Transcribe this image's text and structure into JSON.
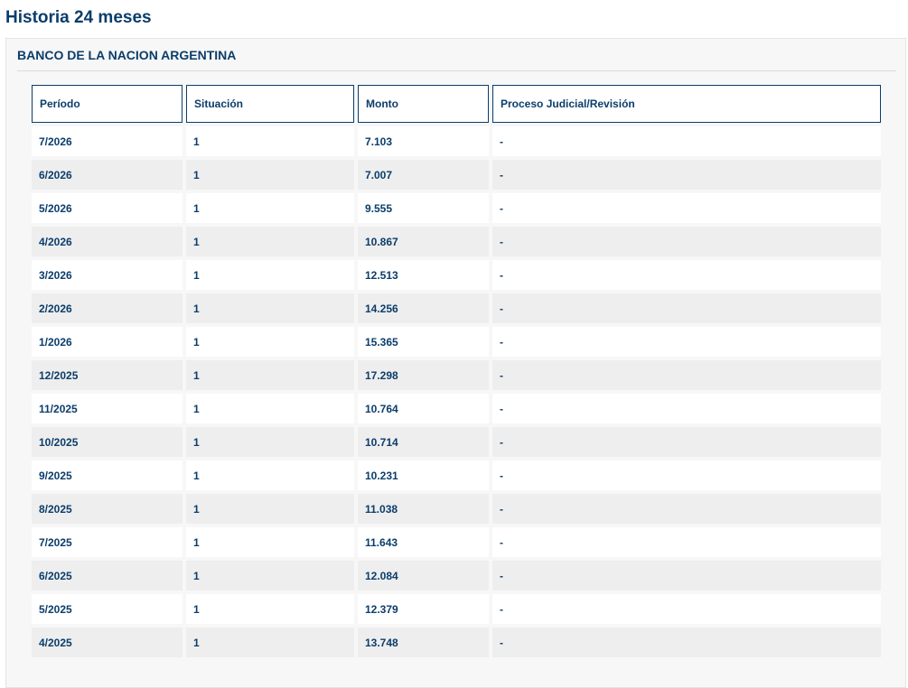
{
  "page": {
    "title": "Historia 24 meses"
  },
  "bank": {
    "name": "BANCO DE LA NACION ARGENTINA"
  },
  "table": {
    "headers": [
      "Período",
      "Situación",
      "Monto",
      "Proceso Judicial/Revisión"
    ],
    "rows": [
      [
        "7/2026",
        "1",
        "7.103",
        "-"
      ],
      [
        "6/2026",
        "1",
        "7.007",
        "-"
      ],
      [
        "5/2026",
        "1",
        "9.555",
        "-"
      ],
      [
        "4/2026",
        "1",
        "10.867",
        "-"
      ],
      [
        "3/2026",
        "1",
        "12.513",
        "-"
      ],
      [
        "2/2026",
        "1",
        "14.256",
        "-"
      ],
      [
        "1/2026",
        "1",
        "15.365",
        "-"
      ],
      [
        "12/2025",
        "1",
        "17.298",
        "-"
      ],
      [
        "11/2025",
        "1",
        "10.764",
        "-"
      ],
      [
        "10/2025",
        "1",
        "10.714",
        "-"
      ],
      [
        "9/2025",
        "1",
        "10.231",
        "-"
      ],
      [
        "8/2025",
        "1",
        "11.038",
        "-"
      ],
      [
        "7/2025",
        "1",
        "11.643",
        "-"
      ],
      [
        "6/2025",
        "1",
        "12.084",
        "-"
      ],
      [
        "5/2025",
        "1",
        "12.379",
        "-"
      ],
      [
        "4/2025",
        "1",
        "13.748",
        "-"
      ]
    ]
  },
  "colors": {
    "text": "#0b3d6b",
    "row_alt": "#eeeeee",
    "card_bg": "#f7f7f7"
  }
}
